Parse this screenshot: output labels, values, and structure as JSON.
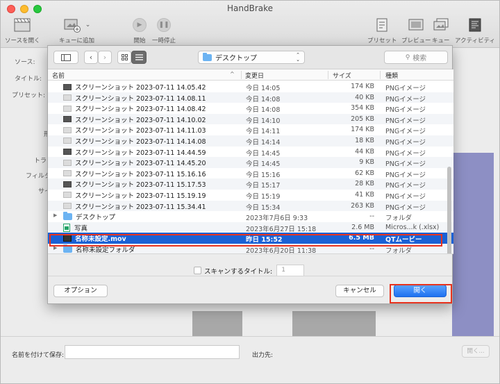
{
  "window": {
    "title": "HandBrake"
  },
  "toolbar": {
    "left_items": [
      {
        "label": "ソースを開く",
        "icon": "film-clapper-icon"
      },
      {
        "label": "キューに追加",
        "icon": "add-to-queue-icon"
      },
      {
        "label": "開始",
        "icon": "play-icon"
      },
      {
        "label": "一時停止",
        "icon": "pause-icon"
      }
    ],
    "right_items": [
      {
        "label": "プリセット",
        "icon": "presets-icon"
      },
      {
        "label": "プレビュー",
        "icon": "preview-icon"
      },
      {
        "label": "キュー",
        "icon": "queue-icon"
      },
      {
        "label": "アクティビティ",
        "icon": "activity-icon"
      }
    ]
  },
  "main": {
    "source_label": "ソース:",
    "title_label": "タイトル:",
    "preset_label": "プリセット:",
    "partial_labels": [
      "形",
      "トラッ",
      "フィルタ",
      "サイ"
    ],
    "save_as_label": "名前を付けて保存:",
    "destination_label": "出力先:",
    "browse_button": "開く..."
  },
  "sheet": {
    "location": "デスクトップ",
    "search_placeholder": "検索",
    "columns": {
      "name": "名前",
      "modified": "変更日",
      "size": "サイズ",
      "kind": "種類"
    },
    "rows": [
      {
        "name": "スクリーンショット 2023-07-11 14.05.42",
        "date": "今日 14:05",
        "size": "174 KB",
        "kind": "PNGイメージ",
        "icon": "screenshot-thumb-icon"
      },
      {
        "name": "スクリーンショット 2023-07-11 14.08.11",
        "date": "今日 14:08",
        "size": "40 KB",
        "kind": "PNGイメージ",
        "icon": "screenshot-thumb-icon"
      },
      {
        "name": "スクリーンショット 2023-07-11 14.08.42",
        "date": "今日 14:08",
        "size": "354 KB",
        "kind": "PNGイメージ",
        "icon": "screenshot-thumb-icon"
      },
      {
        "name": "スクリーンショット 2023-07-11 14.10.02",
        "date": "今日 14:10",
        "size": "205 KB",
        "kind": "PNGイメージ",
        "icon": "screenshot-thumb-icon"
      },
      {
        "name": "スクリーンショット 2023-07-11 14.11.03",
        "date": "今日 14:11",
        "size": "174 KB",
        "kind": "PNGイメージ",
        "icon": "screenshot-thumb-icon"
      },
      {
        "name": "スクリーンショット 2023-07-11 14.14.08",
        "date": "今日 14:14",
        "size": "18 KB",
        "kind": "PNGイメージ",
        "icon": "screenshot-thumb-icon"
      },
      {
        "name": "スクリーンショット 2023-07-11 14.44.59",
        "date": "今日 14:45",
        "size": "44 KB",
        "kind": "PNGイメージ",
        "icon": "screenshot-thumb-icon"
      },
      {
        "name": "スクリーンショット 2023-07-11 14.45.20",
        "date": "今日 14:45",
        "size": "9 KB",
        "kind": "PNGイメージ",
        "icon": "screenshot-thumb-icon"
      },
      {
        "name": "スクリーンショット 2023-07-11 15.16.16",
        "date": "今日 15:16",
        "size": "62 KB",
        "kind": "PNGイメージ",
        "icon": "screenshot-thumb-icon"
      },
      {
        "name": "スクリーンショット 2023-07-11 15.17.53",
        "date": "今日 15:17",
        "size": "28 KB",
        "kind": "PNGイメージ",
        "icon": "screenshot-thumb-icon"
      },
      {
        "name": "スクリーンショット 2023-07-11 15.19.19",
        "date": "今日 15:19",
        "size": "41 KB",
        "kind": "PNGイメージ",
        "icon": "screenshot-thumb-icon"
      },
      {
        "name": "スクリーンショット 2023-07-11 15.34.41",
        "date": "今日 15:34",
        "size": "263 KB",
        "kind": "PNGイメージ",
        "icon": "screenshot-thumb-icon"
      },
      {
        "name": "デスクトップ",
        "date": "2023年7月6日 9:33",
        "size": "--",
        "kind": "フォルダ",
        "icon": "folder-icon",
        "folder": true
      },
      {
        "name": "写真",
        "date": "2023年6月27日 15:18",
        "size": "2.6 MB",
        "kind": "Micros...k (.xlsx)",
        "icon": "excel-file-icon"
      },
      {
        "name": "名称未設定.mov",
        "date": "昨日 15:52",
        "size": "6.5 MB",
        "kind": "QTムービー",
        "icon": "movie-file-icon",
        "selected": true
      },
      {
        "name": "名称未設定フォルダ",
        "date": "2023年6月20日 11:38",
        "size": "--",
        "kind": "フォルダ",
        "icon": "folder-icon",
        "folder": true
      }
    ],
    "scan_label": "スキャンするタイトル:",
    "scan_value": "1",
    "options_button": "オプション",
    "cancel_button": "キャンセル",
    "open_button": "開く"
  },
  "colors": {
    "selection": "#1a61d5",
    "highlight_outline": "#e8321d",
    "primary_button": "#1f71f0"
  }
}
